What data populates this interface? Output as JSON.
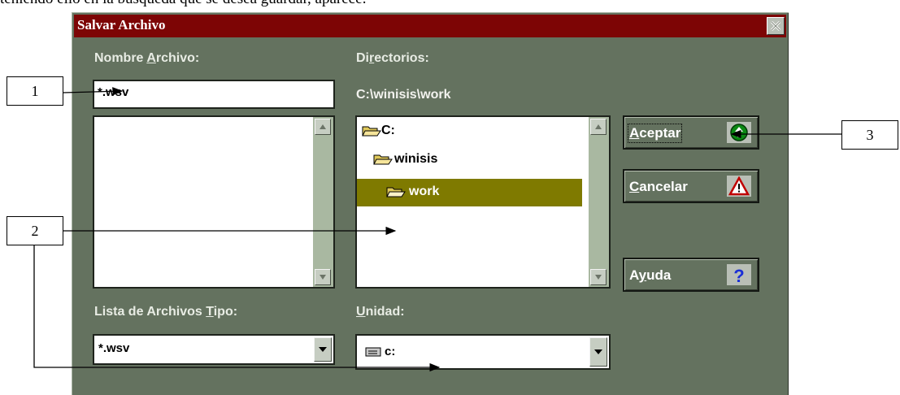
{
  "document": {
    "text_fragment": "teniendo ello en la búsqueda que se desea guardar, aparece:"
  },
  "dialog": {
    "title": "Salvar Archivo",
    "filename_label": {
      "before": "Nombre ",
      "key": "A",
      "after": "rchivo:"
    },
    "filename_value": "*.wsv",
    "directories_label": {
      "before": "Di",
      "key": "r",
      "after": "ectorios:"
    },
    "current_path": "C:\\winisis\\work",
    "directories": [
      {
        "name": "C:",
        "level": 0,
        "selected": false
      },
      {
        "name": "winisis",
        "level": 1,
        "selected": false
      },
      {
        "name": "work",
        "level": 2,
        "selected": true
      }
    ],
    "file_types_label": {
      "before": "Lista de Archivos ",
      "key": "T",
      "after": "ipo:"
    },
    "file_type_value": "*.wsv",
    "drive_label": {
      "before": "",
      "key": "U",
      "after": "nidad:"
    },
    "drive_value": "c:",
    "buttons": {
      "ok": {
        "before": "",
        "key": "A",
        "after": "ceptar",
        "icon": "green-up-arrow-icon"
      },
      "cancel": {
        "before": "",
        "key": "C",
        "after": "ancelar",
        "icon": "warning-triangle-icon"
      },
      "help": {
        "before": "A",
        "key": "y",
        "after": "uda",
        "icon": "question-mark-icon"
      }
    }
  },
  "annotations": [
    "1",
    "2",
    "3"
  ],
  "colors": {
    "titlebar": "#7d0505",
    "dialog_bg": "#64725f",
    "selection": "#7f7a00"
  }
}
